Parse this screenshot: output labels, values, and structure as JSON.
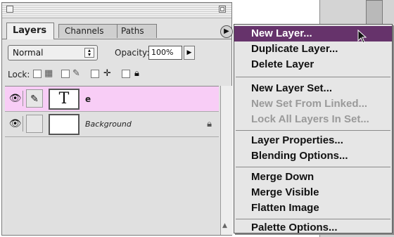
{
  "palette": {
    "tabs": [
      {
        "label": "Layers",
        "active": true
      },
      {
        "label": "Channels",
        "active": false
      },
      {
        "label": "Paths",
        "active": false
      }
    ],
    "menu_button_icon": "triangle-right-icon",
    "blend_mode": "Normal",
    "opacity_label": "Opacity:",
    "opacity_value": "100%",
    "lock_label": "Lock:",
    "lock_icons": [
      "checkerboard-icon",
      "brush-icon",
      "move-icon",
      "padlock-icon"
    ],
    "layers": [
      {
        "name": "e",
        "thumbnail": "T",
        "type": "text",
        "selected": true,
        "visible": true,
        "locked": false
      },
      {
        "name": "Background",
        "thumbnail": "",
        "type": "image",
        "selected": false,
        "visible": true,
        "locked": true
      }
    ],
    "selection_color": "#f8cdf6"
  },
  "menu": {
    "groups": [
      [
        {
          "label": "New Layer...",
          "highlighted": true,
          "disabled": false
        },
        {
          "label": "Duplicate Layer...",
          "highlighted": false,
          "disabled": false
        },
        {
          "label": "Delete Layer",
          "highlighted": false,
          "disabled": false
        }
      ],
      [
        {
          "label": "New Layer Set...",
          "highlighted": false,
          "disabled": false
        },
        {
          "label": "New Set From Linked...",
          "highlighted": false,
          "disabled": true
        },
        {
          "label": "Lock All Layers In Set...",
          "highlighted": false,
          "disabled": true
        }
      ],
      [
        {
          "label": "Layer Properties...",
          "highlighted": false,
          "disabled": false
        },
        {
          "label": "Blending Options...",
          "highlighted": false,
          "disabled": false
        }
      ],
      [
        {
          "label": "Merge Down",
          "highlighted": false,
          "disabled": false
        },
        {
          "label": "Merge Visible",
          "highlighted": false,
          "disabled": false
        },
        {
          "label": "Flatten Image",
          "highlighted": false,
          "disabled": false
        }
      ],
      [
        {
          "label": "Palette Options...",
          "highlighted": false,
          "disabled": false
        }
      ]
    ],
    "highlight_color": "#66336b"
  }
}
